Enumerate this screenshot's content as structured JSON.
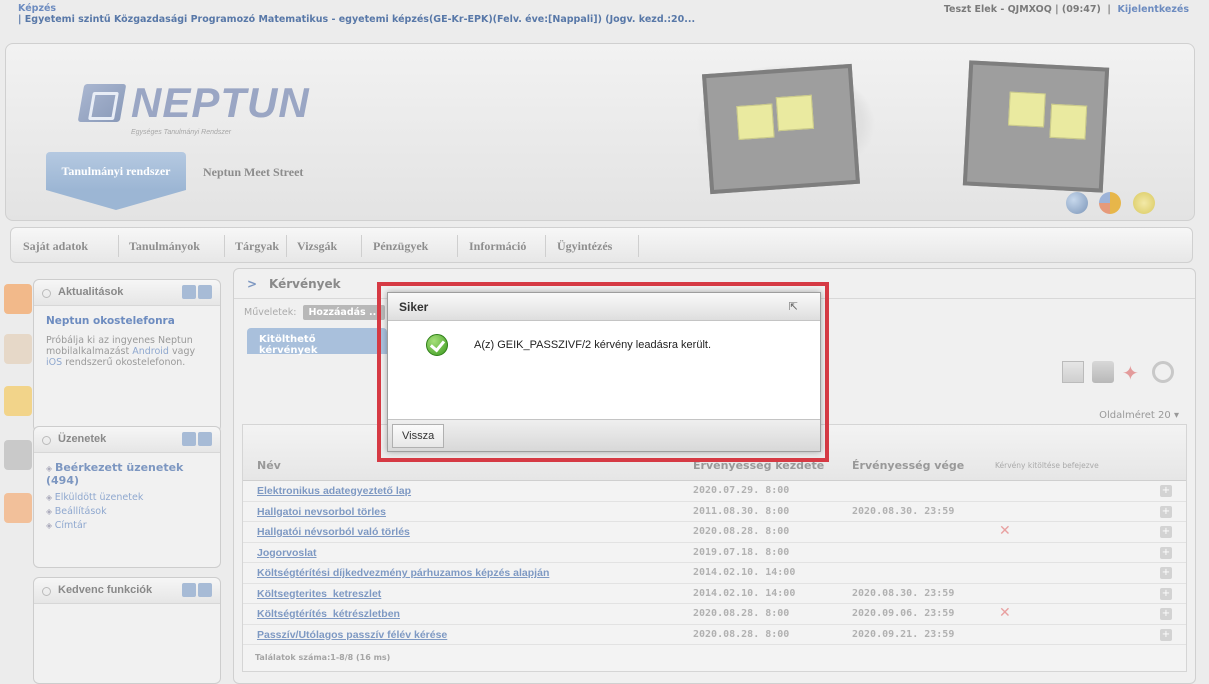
{
  "topbar": {
    "section": "Képzés",
    "training": "| Egyetemi szintű Közgazdasági Programozó Matematikus - egyetemi képzés(GE-Kr-EPK)(Felv. éve:[Nappali]) (Jogv. kezd.:20...",
    "user": "Teszt Elek - QJMXOQ  |  (09:47)",
    "logout": "Kijelentkezés"
  },
  "header": {
    "logo_word": "NEPTUN",
    "logo_sub": "Egységes Tanulmányi Rendszer",
    "tab_main": "Tanulmányi rendszer",
    "tab_second": "Neptun Meet Street"
  },
  "menu": {
    "items": [
      "Saját adatok",
      "Tanulmányok",
      "Tárgyak",
      "Vizsgák",
      "Pénzügyek",
      "Információ",
      "Ügyintézés"
    ]
  },
  "side": {
    "news": {
      "title": "Aktualitások",
      "headline": "Neptun okostelefonra",
      "text1": "Próbálja ki az ingyenes Neptun mobilalkalmazást",
      "android": "Android",
      "text2": "vagy",
      "ios": "iOS",
      "text3": "rendszerű okostelefonon."
    },
    "messages": {
      "title": "Üzenetek",
      "items": [
        "Beérkezett üzenetek (494)",
        "Elküldött üzenetek",
        "Beállítások",
        "Címtár"
      ]
    },
    "favorites": {
      "title": "Kedvenc funkciók"
    }
  },
  "main": {
    "title": "Kérvények",
    "ops_label": "Műveletek:",
    "ops_button": "Hozzáadás ...",
    "subtab": "Kitölthető kérvények",
    "pagesize_label": "Oldalméret",
    "pagesize_value": "20",
    "columns": {
      "name": "Név",
      "start": "Érvényesség kezdete",
      "end": "Érvényesség vége",
      "done": "Kérvény kitöltése befejezve"
    },
    "rows": [
      {
        "name": "Elektronikus adategyeztető lap",
        "start": "2020.07.29. 8:00",
        "end": "",
        "x": ""
      },
      {
        "name": "Hallgatoi nevsorbol törles",
        "start": "2011.08.30. 8:00",
        "end": "2020.08.30. 23:59",
        "x": ""
      },
      {
        "name": "Hallgatói névsorból való törlés",
        "start": "2020.08.28. 8:00",
        "end": "",
        "x": "✕"
      },
      {
        "name": "Jogorvoslat",
        "start": "2019.07.18. 8:00",
        "end": "",
        "x": ""
      },
      {
        "name": "Költségtérítési díjkedvezmény párhuzamos képzés alapján",
        "start": "2014.02.10. 14:00",
        "end": "",
        "x": ""
      },
      {
        "name": "Költsegterites_ketreszlet",
        "start": "2014.02.10. 14:00",
        "end": "2020.08.30. 23:59",
        "x": ""
      },
      {
        "name": "Költségtérítés_kétrészletben",
        "start": "2020.08.28. 8:00",
        "end": "2020.09.06. 23:59",
        "x": "✕"
      },
      {
        "name": "Passzív/Utólagos passzív félév kérése",
        "start": "2020.08.28. 8:00",
        "end": "2020.09.21. 23:59",
        "x": ""
      }
    ],
    "footer": "Találatok száma:1-8/8 (16 ms)"
  },
  "dialog": {
    "title": "Siker",
    "message": "A(z) GEIK_PASSZIVF/2 kérvény leadásra került.",
    "button": "Vissza"
  },
  "colors": {
    "highlight": "#d63a44",
    "accent": "#6d8cc0"
  }
}
